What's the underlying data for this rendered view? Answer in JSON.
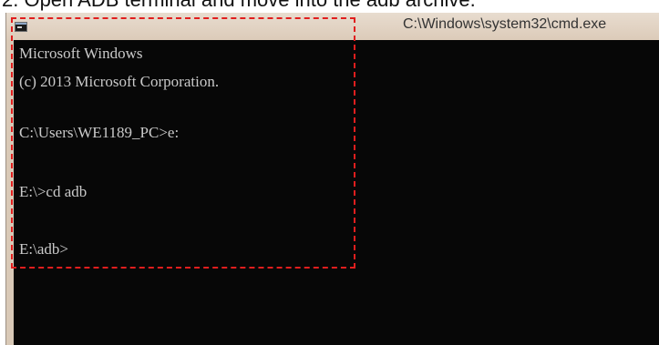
{
  "heading": "2. Open ADB terminal and move into the adb archive.",
  "window": {
    "title": "C:\\Windows\\system32\\cmd.exe",
    "icon": "cmd-icon"
  },
  "console": {
    "lines": [
      "Microsoft Windows",
      "(c) 2013 Microsoft Corporation.",
      "C:\\Users\\WE1189_PC>e:",
      "E:\\>cd adb",
      "E:\\adb>"
    ]
  },
  "colors": {
    "console_bg": "#070707",
    "console_text": "#c9c9c9",
    "titlebar": "#dccbb9",
    "highlight": "#e01e1e"
  }
}
